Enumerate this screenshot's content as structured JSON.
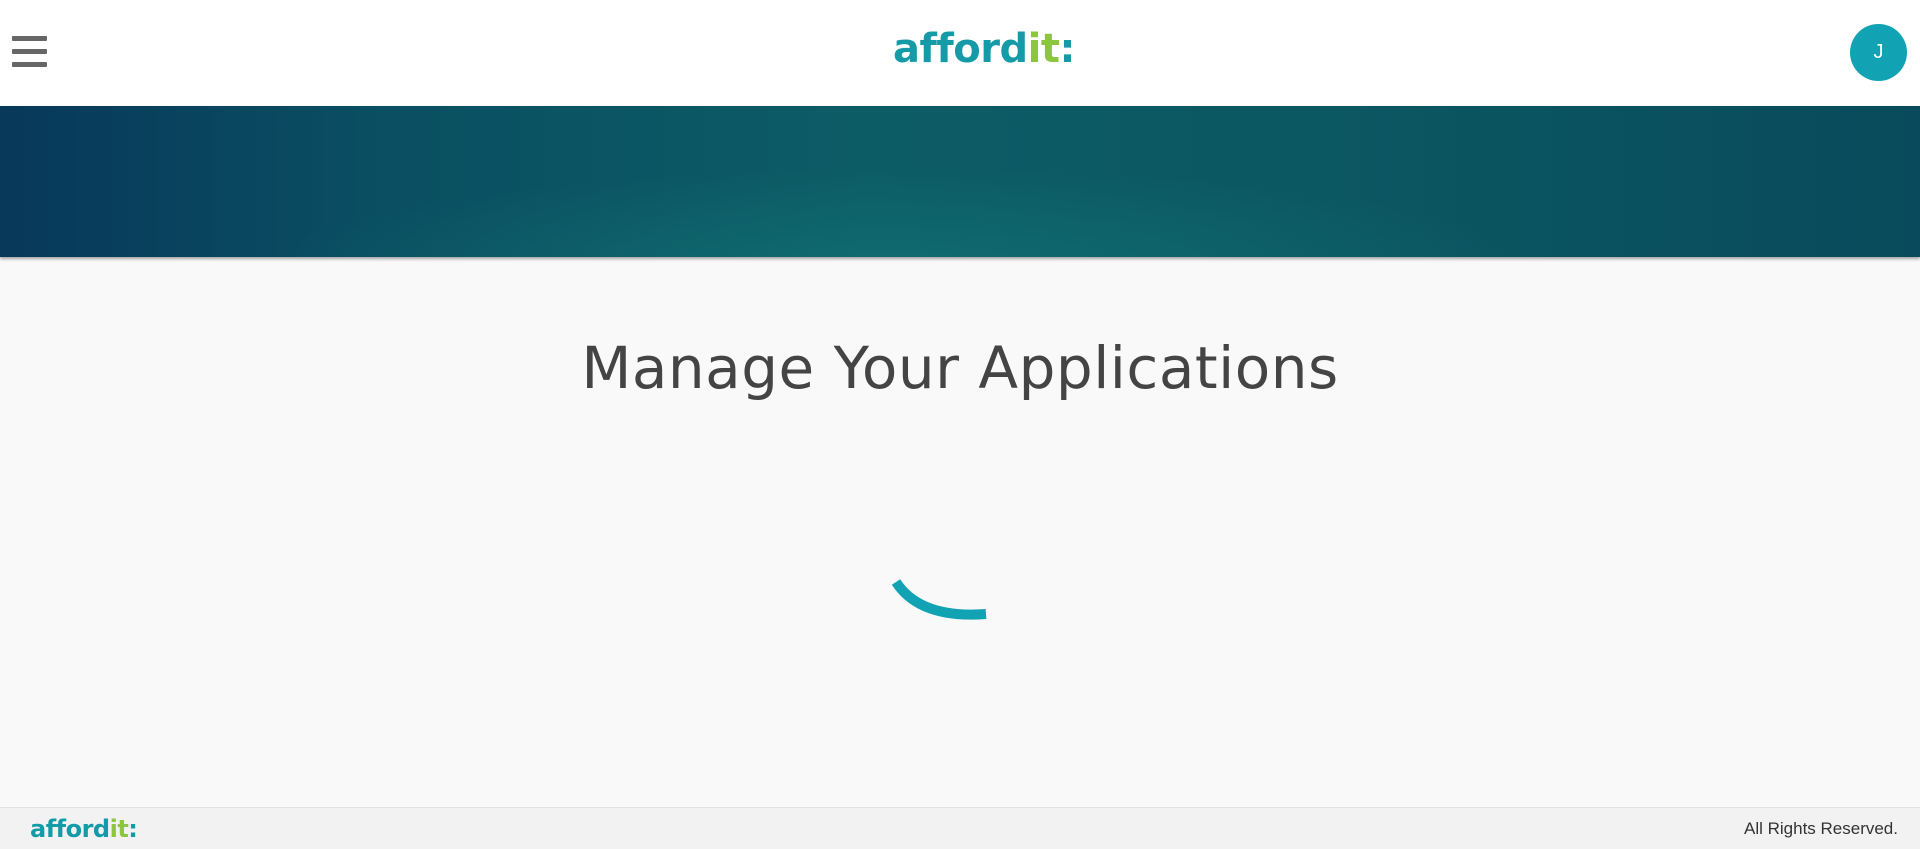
{
  "header": {
    "logo": {
      "part1": "afford",
      "part2": "it",
      "mark": ":"
    },
    "avatar_initial": "J"
  },
  "main": {
    "title": "Manage Your Applications"
  },
  "footer": {
    "logo": {
      "part1": "afford",
      "part2": "it",
      "mark": ":"
    },
    "rights": "All Rights Reserved."
  },
  "icons": {
    "menu": "hamburger-menu-icon",
    "loading": "loading-spinner-icon"
  },
  "colors": {
    "brand_teal": "#159aa8",
    "brand_green": "#8cc63f",
    "avatar_bg": "#11a3b4",
    "banner_dark": "#08385a",
    "banner_teal": "#0c5c66"
  }
}
